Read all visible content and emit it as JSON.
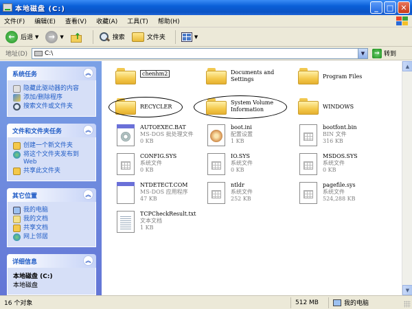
{
  "window": {
    "title": "本地磁盘 (C:)"
  },
  "menu": [
    "文件(F)",
    "编辑(E)",
    "查看(V)",
    "收藏(A)",
    "工具(T)",
    "帮助(H)"
  ],
  "toolbar": {
    "back_label": "后退",
    "search_label": "搜索",
    "folders_label": "文件夹"
  },
  "address": {
    "label": "地址(D)",
    "value": "C:\\",
    "go_label": "转到"
  },
  "sidebar": {
    "system_tasks": {
      "title": "系统任务",
      "items": [
        "隐藏此驱动器的内容",
        "添加/删除程序",
        "搜索文件或文件夹"
      ]
    },
    "file_tasks": {
      "title": "文件和文件夹任务",
      "items": [
        "创建一个新文件夹",
        "将这个文件夹发布到 Web",
        "共享此文件夹"
      ]
    },
    "other_places": {
      "title": "其它位置",
      "items": [
        "我的电脑",
        "我的文档",
        "共享文档",
        "网上邻居"
      ]
    },
    "details": {
      "title": "详细信息",
      "name": "本地磁盘 (C:)",
      "type": "本地磁盘"
    }
  },
  "folders": [
    {
      "name": "chenhm2"
    },
    {
      "name": "Documents and Settings"
    },
    {
      "name": "Program Files"
    },
    {
      "name": "RECYCLER"
    },
    {
      "name": "System Volume Information"
    },
    {
      "name": "WINDOWS"
    }
  ],
  "files": [
    {
      "name": "AUTOEXEC.BAT",
      "type": "MS-DOS 批处理文件",
      "size": "0 KB",
      "icon": "batch-file-icon"
    },
    {
      "name": "boot.ini",
      "type": "配置设置",
      "size": "1 KB",
      "icon": "config-file-icon"
    },
    {
      "name": "bootfont.bin",
      "type": "BIN 文件",
      "size": "316 KB",
      "icon": "system-file-icon"
    },
    {
      "name": "CONFIG.SYS",
      "type": "系统文件",
      "size": "0 KB",
      "icon": "system-file-icon"
    },
    {
      "name": "IO.SYS",
      "type": "系统文件",
      "size": "0 KB",
      "icon": "system-file-icon"
    },
    {
      "name": "MSDOS.SYS",
      "type": "系统文件",
      "size": "0 KB",
      "icon": "system-file-icon"
    },
    {
      "name": "NTDETECT.COM",
      "type": "MS-DOS 应用程序",
      "size": "47 KB",
      "icon": "dos-app-icon"
    },
    {
      "name": "ntldr",
      "type": "系统文件",
      "size": "252 KB",
      "icon": "system-file-icon"
    },
    {
      "name": "pagefile.sys",
      "type": "系统文件",
      "size": "524,288 KB",
      "icon": "system-file-icon"
    },
    {
      "name": "TCPCheckResult.txt",
      "type": "文本文档",
      "size": "1 KB",
      "icon": "text-file-icon"
    }
  ],
  "status": {
    "count": "16 个对象",
    "size": "512 MB",
    "location": "我的电脑"
  },
  "colors": {
    "title_bar": "#0b53c4",
    "sidebar": "#6f8fe0",
    "panel_text": "#215dc6",
    "folder": "#f4c84a"
  }
}
